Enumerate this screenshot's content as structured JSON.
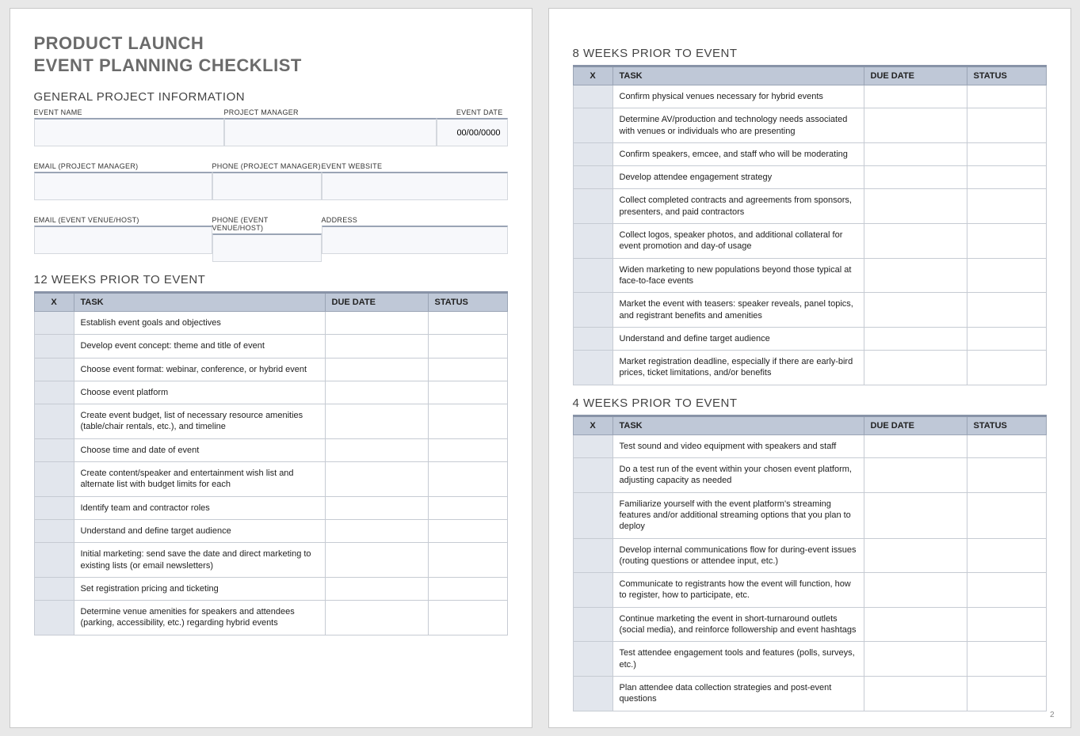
{
  "title_line1": "PRODUCT LAUNCH",
  "title_line2": "EVENT PLANNING CHECKLIST",
  "general": {
    "heading": "GENERAL PROJECT INFORMATION",
    "event_name_label": "EVENT NAME",
    "project_manager_label": "PROJECT MANAGER",
    "event_date_label": "EVENT DATE",
    "event_date_value": "00/00/0000",
    "email_pm_label": "EMAIL (PROJECT MANAGER)",
    "phone_pm_label": "PHONE (PROJECT MANAGER)",
    "event_website_label": "EVENT WEBSITE",
    "email_venue_label": "EMAIL (EVENT VENUE/HOST)",
    "phone_venue_label": "PHONE (EVENT VENUE/HOST)",
    "address_label": "ADDRESS"
  },
  "columns": {
    "x": "X",
    "task": "TASK",
    "due": "DUE DATE",
    "status": "STATUS"
  },
  "sections": [
    {
      "heading": "12 WEEKS PRIOR TO EVENT",
      "tasks": [
        "Establish event goals and objectives",
        "Develop event concept: theme and title of event",
        "Choose event format: webinar, conference, or hybrid event",
        "Choose event platform",
        "Create event budget, list of necessary resource amenities (table/chair rentals, etc.), and timeline",
        "Choose time and date of event",
        "Create content/speaker and entertainment wish list and alternate list with budget limits for each",
        "Identify team and contractor roles",
        "Understand and define target audience",
        "Initial marketing: send save the date and direct marketing to existing lists (or email newsletters)",
        "Set registration pricing and ticketing",
        "Determine venue amenities for speakers and attendees (parking, accessibility, etc.) regarding hybrid events"
      ]
    },
    {
      "heading": "8 WEEKS PRIOR TO EVENT",
      "tasks": [
        "Confirm physical venues necessary for hybrid events",
        "Determine AV/production and technology needs associated with venues or individuals who are presenting",
        "Confirm speakers, emcee, and staff who will be moderating",
        "Develop attendee engagement strategy",
        "Collect completed contracts and agreements from sponsors, presenters, and paid contractors",
        "Collect logos, speaker photos, and additional collateral for event promotion and day-of usage",
        "Widen marketing to new populations beyond those typical at face-to-face events",
        "Market the event with teasers: speaker reveals, panel topics, and registrant benefits and amenities",
        "Understand and define target audience",
        "Market registration deadline, especially if there are early-bird prices, ticket limitations, and/or benefits"
      ]
    },
    {
      "heading": "4 WEEKS PRIOR TO EVENT",
      "tasks": [
        "Test sound and video equipment with speakers and staff",
        "Do a test run of the event within your chosen event platform, adjusting capacity as needed",
        "Familiarize yourself with the event platform's streaming features and/or additional streaming options that you plan to deploy",
        "Develop internal communications flow for during-event issues (routing questions or attendee input, etc.)",
        "Communicate to registrants how the event will function, how to register, how to participate, etc.",
        "Continue marketing the event in short-turnaround outlets (social media), and reinforce followership and event hashtags",
        "Test attendee engagement tools and features (polls, surveys, etc.)",
        "Plan attendee data collection strategies and post-event questions"
      ]
    }
  ],
  "page_number": "2"
}
